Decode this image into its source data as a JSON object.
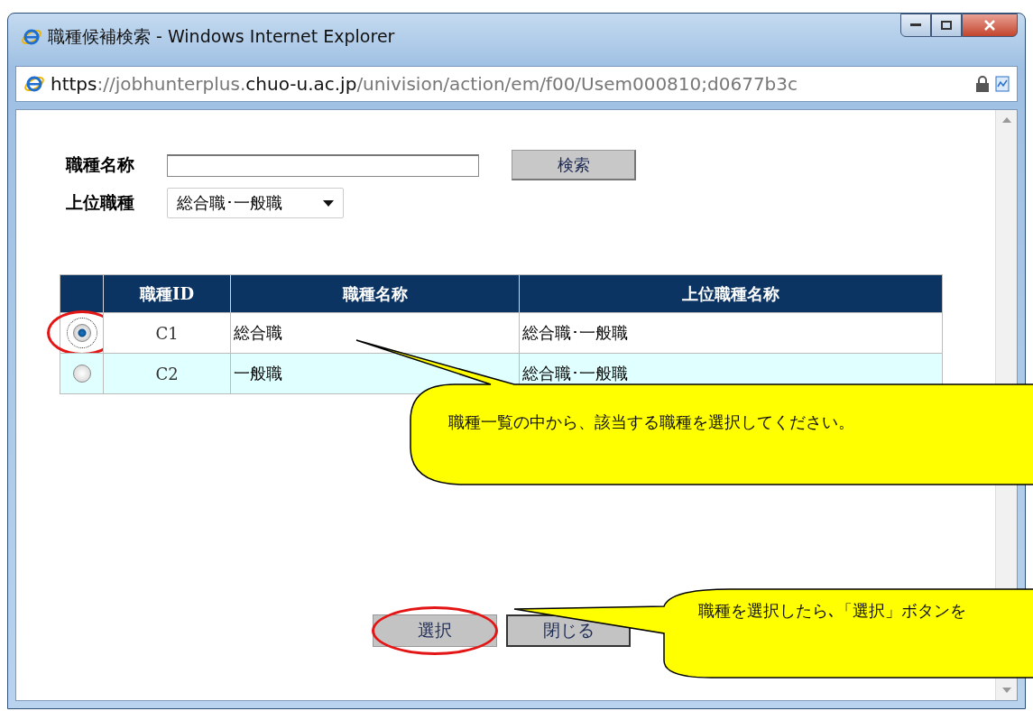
{
  "window": {
    "title": "職種候補検索 - Windows Internet Explorer",
    "address": {
      "scheme": "https",
      "separator": "://",
      "host_start": "jobhunterplus.",
      "host": "chuo-u.ac.jp",
      "path": "/univision/action/em/f00/Usem000810;d0677b3c"
    }
  },
  "form": {
    "name_label": "職種名称",
    "search_button": "検索",
    "parent_label": "上位職種",
    "parent_value": "総合職･一般職"
  },
  "table": {
    "columns": [
      "職種ID",
      "職種名称",
      "上位職種名称"
    ],
    "rows": [
      {
        "selected": true,
        "circled": true,
        "id": "C1",
        "name": "総合職",
        "parent": "総合職･一般職"
      },
      {
        "selected": false,
        "circled": false,
        "id": "C2",
        "name": "一般職",
        "parent": "総合職･一般職"
      }
    ]
  },
  "buttons": [
    {
      "label": "選択",
      "circled": true
    },
    {
      "label": "閉じる",
      "circled": false
    }
  ],
  "callouts": [
    {
      "text": "職種一覧の中から、該当する職種を選択してください。"
    },
    {
      "text": "職種を選択したら､「選択」ボタンを"
    }
  ]
}
